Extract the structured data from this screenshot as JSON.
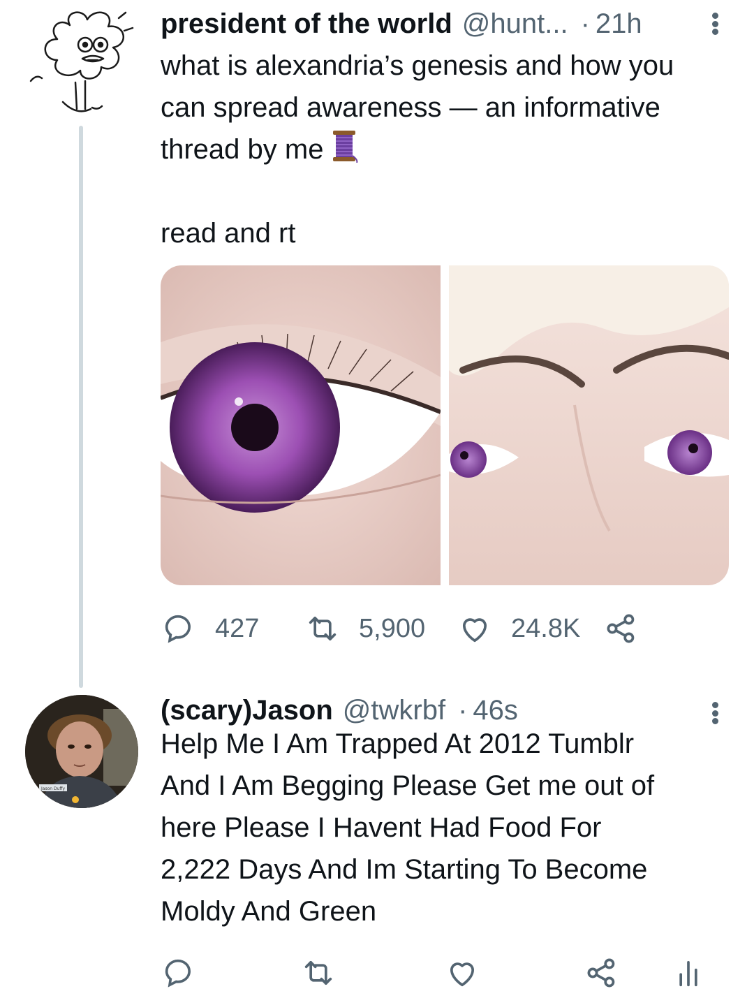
{
  "tweets": [
    {
      "display_name": "president of the world",
      "handle": "@hunt...",
      "separator": "·",
      "time": "21h",
      "text_lines": [
        "what is alexandria’s genesis and how you",
        "can spread awareness — an informative",
        "thread by me"
      ],
      "text_line2": "read and rt",
      "spool_emoji": "thread-spool-icon",
      "images": [
        "purple-eye-closeup-image",
        "purple-eyes-face-image"
      ],
      "reply_count": "427",
      "retweet_count": "5,900",
      "like_count": "24.8K"
    },
    {
      "display_name": "(scary)Jason",
      "handle": "@twkrbf",
      "separator": "·",
      "time": "46s",
      "text_lines": [
        "Help Me I Am Trapped At 2012 Tumblr",
        "And I Am Begging Please Get me out of",
        "here Please I Havent Had Food For",
        "2,222 Days And Im Starting To Become",
        "Moldy And Green"
      ],
      "reply_count": "",
      "retweet_count": "",
      "like_count": ""
    }
  ],
  "avatar_caption": "Jason Duffy",
  "colors": {
    "text_primary": "#0f1419",
    "text_secondary": "#536471",
    "thread_line": "#cfd9de",
    "eye_purple": "#8a3fa0"
  }
}
